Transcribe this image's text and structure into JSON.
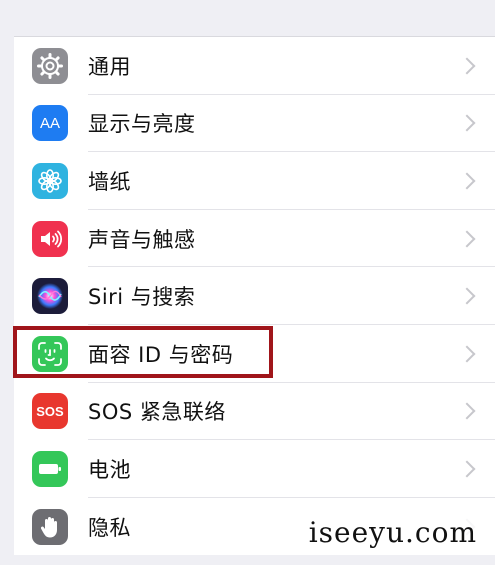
{
  "settings": {
    "items": [
      {
        "label": "通用",
        "icon": "gear-icon",
        "color": "#8e8e93"
      },
      {
        "label": "显示与亮度",
        "icon": "display-brightness-icon",
        "icon_text": "AA",
        "color": "#1e7cf2"
      },
      {
        "label": "墙纸",
        "icon": "wallpaper-flower-icon",
        "color": "#2fb3e0"
      },
      {
        "label": "声音与触感",
        "icon": "speaker-icon",
        "color": "#f0314f"
      },
      {
        "label": "Siri 与搜索",
        "icon": "siri-icon",
        "color": "#1c1c3a"
      },
      {
        "label": "面容 ID 与密码",
        "icon": "face-id-icon",
        "color": "#34c759"
      },
      {
        "label": "SOS 紧急联络",
        "icon": "sos-icon",
        "icon_text": "SOS",
        "color": "#e8372e"
      },
      {
        "label": "电池",
        "icon": "battery-icon",
        "color": "#34c759"
      },
      {
        "label": "隐私",
        "icon": "hand-privacy-icon",
        "color": "#6d6d72"
      }
    ]
  },
  "highlight_color": "#a0151a",
  "watermark": "iseeyu.com"
}
